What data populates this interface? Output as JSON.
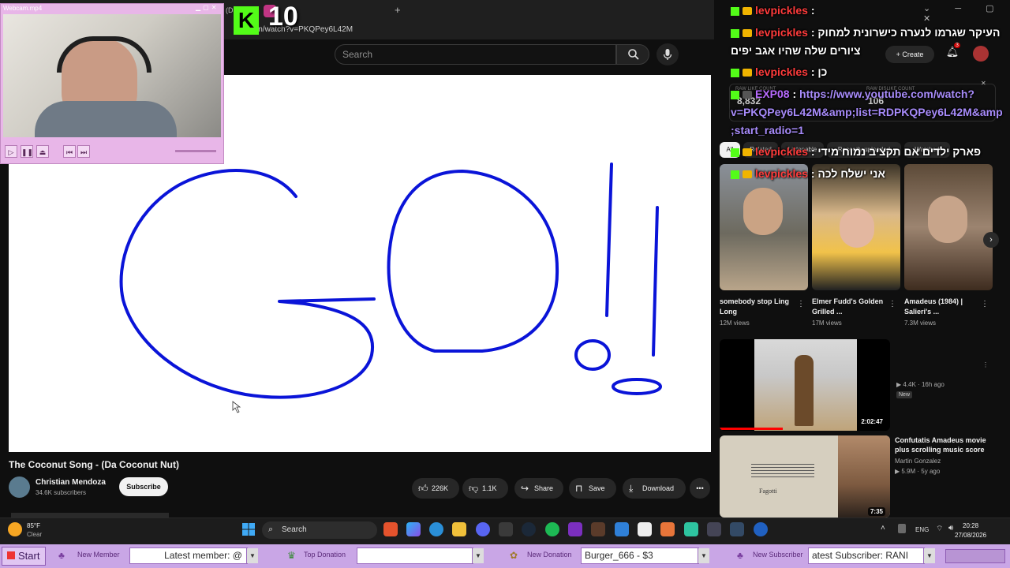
{
  "browser": {
    "url": "be.com/watch?v=PKQPey6L42M",
    "tab_partial": "(Da"
  },
  "youtube": {
    "search_placeholder": "Search",
    "create_label": "Create",
    "notifications_count": "3",
    "stats": {
      "left_label": "RAW LIKE COUNT",
      "left_value": "8,832",
      "right_label": "RAW DISLIKE COUNT",
      "right_value": "106"
    },
    "chips": [
      "All",
      "Related",
      "Listenable",
      "Recently uploaded",
      "Watched"
    ],
    "video": {
      "title": "The Coconut Song - (Da Coconut Nut)",
      "channel": "Christian Mendoza",
      "subscribers": "34.6K subscribers",
      "subscribe_label": "Subscribe",
      "likes": "226K",
      "dislikes": "1.1K",
      "share_label": "Share",
      "save_label": "Save",
      "download_label": "Download",
      "drawing_text": "GO!!"
    },
    "shorts": [
      {
        "title": "somebody stop Ling Long",
        "views": "12M views"
      },
      {
        "title": "Elmer Fudd's Golden Grilled ...",
        "views": "17M views"
      },
      {
        "title": "Amadeus (1984) | Salieri's ...",
        "views": "7.3M views"
      }
    ],
    "recommendations": [
      {
        "duration": "2:02:47",
        "meta": "4.4K · 16h ago",
        "badge": "New"
      },
      {
        "duration": "7:35",
        "title": "Confutatis Amadeus movie plus scrolling music score",
        "channel": "Martin Gonzalez",
        "meta": "5.9M · 5y ago",
        "score_label": "Fagotti"
      }
    ]
  },
  "chat": [
    {
      "user": "levpickles",
      "text": ""
    },
    {
      "user": "levpickles",
      "text": "העיקר שגרמו לנערה כישרונית למחוק"
    },
    {
      "user": "",
      "text": "ציורים שלה שהיו אגב יפים"
    },
    {
      "user": "levpickles",
      "text": "כן"
    },
    {
      "user": "EXP08",
      "text": "https://www.youtube.com/watch?"
    },
    {
      "user": "",
      "text": "v=PKQPey6L42M&amp;list=RDPKQPey6L42M&amp"
    },
    {
      "user": "",
      "text": ";start_radio=1"
    },
    {
      "user": "levpickles",
      "text": "פארק ילדים אם תקציב נמוח מידי"
    },
    {
      "user": "levpickles",
      "text": "אני ישלח לכה"
    }
  ],
  "webcam": {
    "title": "Webcam.mp4"
  },
  "kick_counter": {
    "value": "10"
  },
  "taskbar": {
    "weather_temp": "85°F",
    "weather_cond": "Clear",
    "search_label": "Search",
    "lang": "ENG",
    "time": "20:28",
    "date": "27/08/2026"
  },
  "streambar": {
    "start": "Start",
    "new_member_label": "New Member",
    "new_member_value": "Latest member: @",
    "top_donation_label": "Top Donation",
    "top_donation_value": "",
    "new_donation_label": "New Donation",
    "new_donation_value": "Burger_666 - $3",
    "new_subscriber_label": "New Subscriber",
    "new_subscriber_value": "atest Subscriber: RANI"
  },
  "colors": {
    "kick_green": "#53fc18",
    "stream_purple": "#c9a6e6",
    "chat_user": "#ff3b3b",
    "drawing_blue": "#0a14d8"
  }
}
